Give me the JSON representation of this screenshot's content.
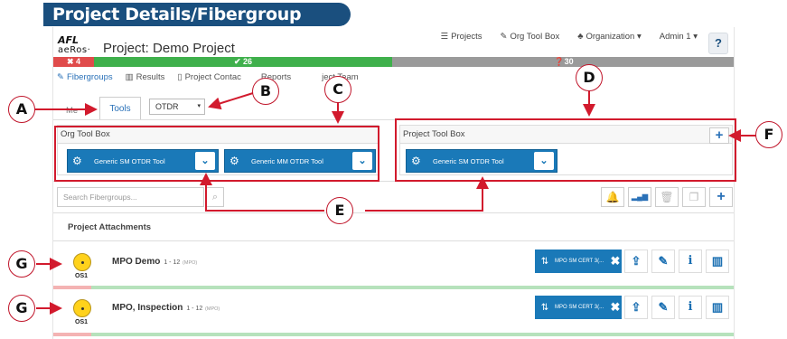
{
  "banner": "Project Details/Fibergroup screen",
  "logo": {
    "line1": "AFL",
    "line2": "aeRos·"
  },
  "project_title": "Project: Demo Project",
  "topnav": [
    {
      "icon": "list-icon",
      "glyph": "☰",
      "label": "Projects"
    },
    {
      "icon": "wrench-icon",
      "glyph": "✎",
      "label": "Org Tool Box"
    },
    {
      "icon": "org-icon",
      "glyph": "♣",
      "label": "Organization ▾"
    },
    {
      "icon": "user-icon",
      "glyph": "",
      "label": "Admin 1 ▾"
    }
  ],
  "help_label": "?",
  "status": {
    "fail": "✖ 4",
    "pass": "✔ 26",
    "pending": "❓30"
  },
  "tabs": [
    {
      "label": "Fibergroups",
      "icon": "wrench-icon",
      "glyph": "✎"
    },
    {
      "label": "Results",
      "icon": "bar-chart-icon",
      "glyph": "▥"
    },
    {
      "label": "Project Contac",
      "icon": "contacts-icon",
      "glyph": "▯"
    },
    {
      "label": "Reports",
      "icon": "reports-icon",
      "glyph": ""
    },
    {
      "label": "ject Team",
      "icon": "team-icon",
      "glyph": ""
    }
  ],
  "subtabs": {
    "meta": "Me",
    "tools": "Tools"
  },
  "select": {
    "value": "OTDR",
    "caret": "▾"
  },
  "org_toolbox": {
    "title": "Org Tool Box",
    "tools": [
      {
        "label": "Generic SM OTDR Tool"
      },
      {
        "label": "Generic MM OTDR Tool"
      }
    ]
  },
  "project_toolbox": {
    "title": "Project Tool Box",
    "add": "+",
    "tools": [
      {
        "label": "Generic SM OTDR Tool"
      }
    ]
  },
  "tool_glyphs": {
    "gear": "⚙",
    "chevron": "⌄"
  },
  "search": {
    "placeholder": "Search Fibergroups...",
    "icon": "⌕"
  },
  "actions": [
    {
      "name": "notify-bell-button",
      "glyph": "🔔"
    },
    {
      "name": "signal-bars-button",
      "glyph": "▂▄▆"
    },
    {
      "name": "delete-button",
      "glyph": "🗑"
    },
    {
      "name": "copy-button",
      "glyph": "❐"
    },
    {
      "name": "add-fibergroup-button",
      "glyph": "+"
    }
  ],
  "attachments_title": "Project Attachments",
  "fibergroups": [
    {
      "name": "MPO Demo",
      "range": "1 - 12",
      "mpo": "(MPO)",
      "badge": "MPO SM CERT 3(...",
      "os": "OS1"
    },
    {
      "name": "MPO, Inspection",
      "range": "1 - 12",
      "mpo": "(MPO)",
      "badge": "MPO SM CERT 3(...",
      "os": "OS1"
    }
  ],
  "row_glyphs": {
    "badge_icon": "⇅",
    "remove": "✖",
    "upload": "⇪",
    "edit": "✎",
    "info": "i",
    "chart": "▥"
  },
  "callouts": [
    "A",
    "B",
    "C",
    "D",
    "E",
    "F",
    "G",
    "G"
  ]
}
